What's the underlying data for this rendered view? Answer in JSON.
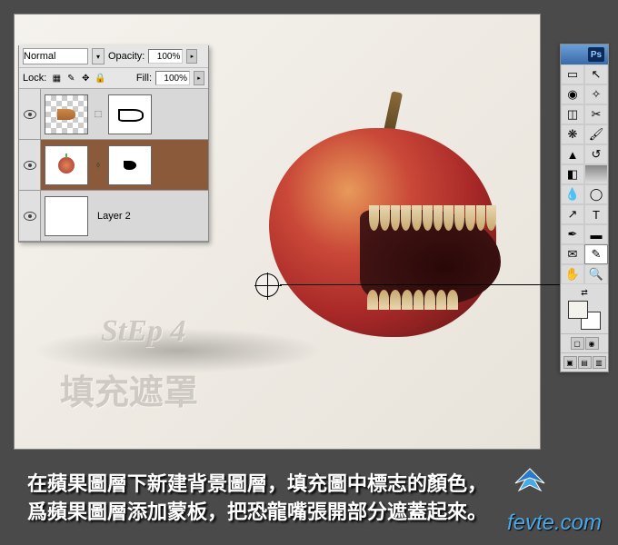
{
  "layers_panel": {
    "blend_mode": "Normal",
    "opacity_label": "Opacity:",
    "opacity_value": "100%",
    "lock_label": "Lock:",
    "fill_label": "Fill:",
    "fill_value": "100%",
    "layers": [
      {
        "name": ""
      },
      {
        "name": ""
      },
      {
        "name": "Layer 2"
      }
    ]
  },
  "watermarks": {
    "step": "StEp 4",
    "title_cn": "填充遮罩"
  },
  "toolbox": {
    "app": "Ps"
  },
  "caption": {
    "line1": "在蘋果圖層下新建背景圖層，填充圖中標志的顏色，",
    "line2": "爲蘋果圖層添加蒙板，把恐龍嘴張開部分遮蓋起來。"
  },
  "site_url": "fevte.com"
}
